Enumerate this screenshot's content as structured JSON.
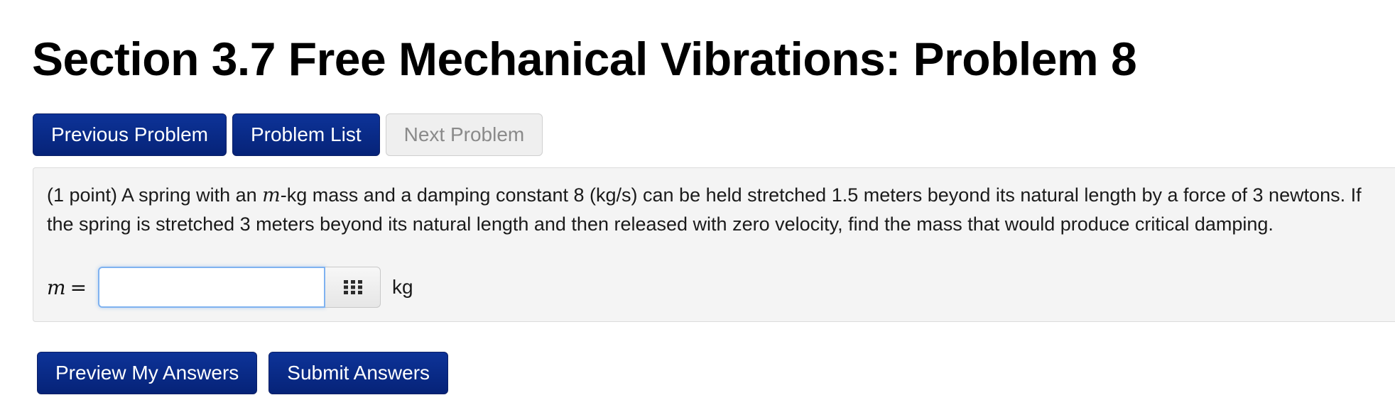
{
  "header": {
    "title": "Section 3.7 Free Mechanical Vibrations: Problem 8"
  },
  "nav": {
    "previous_label": "Previous Problem",
    "list_label": "Problem List",
    "next_label": "Next Problem",
    "next_disabled": true
  },
  "problem": {
    "text_before_var": "(1 point) A spring with an ",
    "variable": "m",
    "text_after_var": "-kg mass and a damping constant 8 (kg/s) can be held stretched 1.5 meters beyond its natural length by a force of 3 newtons. If the spring is stretched 3 meters beyond its natural length and then released with zero velocity, find the mass that would produce critical damping.",
    "answer": {
      "label_var": "m",
      "label_eq": "=",
      "value": "",
      "placeholder": "",
      "units": "kg",
      "palette_icon": "grid-icon"
    }
  },
  "actions": {
    "preview_label": "Preview My Answers",
    "submit_label": "Submit Answers"
  },
  "colors": {
    "primary_button": "#0a2a8f",
    "disabled_button": "#efefef",
    "well_background": "#f4f4f4",
    "input_focus_border": "#7fb2f0"
  }
}
